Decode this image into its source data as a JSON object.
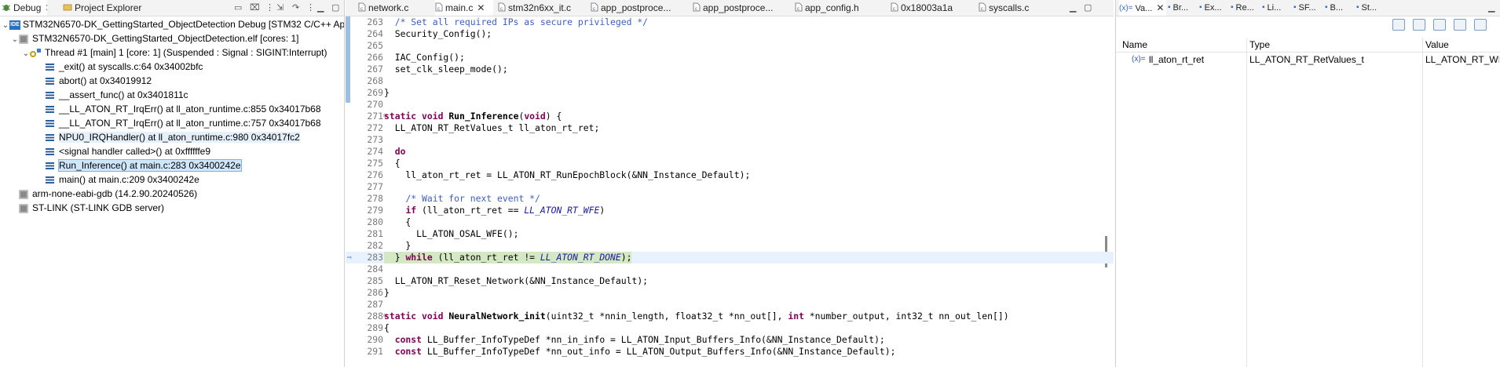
{
  "left_panel": {
    "tabs": [
      {
        "label": "Debug",
        "icon": "debug-bug-icon"
      },
      {
        "label": "Project Explorer",
        "icon": "project-folder-icon"
      }
    ],
    "tree": [
      {
        "level": 0,
        "twist": "open",
        "icon": "ide",
        "text": "STM32N6570-DK_GettingStarted_ObjectDetection Debug [STM32 C/C++ Application]"
      },
      {
        "level": 1,
        "twist": "open",
        "icon": "process",
        "text": "STM32N6570-DK_GettingStarted_ObjectDetection.elf [cores: 1]"
      },
      {
        "level": 2,
        "twist": "open",
        "icon": "thread",
        "text": "Thread #1 [main] 1 [core: 1] (Suspended : Signal : SIGINT:Interrupt)"
      },
      {
        "level": 3,
        "twist": "",
        "icon": "frame",
        "text": "_exit() at syscalls.c:64 0x34002bfc"
      },
      {
        "level": 3,
        "twist": "",
        "icon": "frame",
        "text": "abort() at 0x34019912"
      },
      {
        "level": 3,
        "twist": "",
        "icon": "frame",
        "text": "__assert_func() at 0x3401811c"
      },
      {
        "level": 3,
        "twist": "",
        "icon": "frame",
        "text": "__LL_ATON_RT_IrqErr() at ll_aton_runtime.c:855 0x34017b68"
      },
      {
        "level": 3,
        "twist": "",
        "icon": "frame",
        "text": "__LL_ATON_RT_IrqErr() at ll_aton_runtime.c:757 0x34017b68"
      },
      {
        "level": 3,
        "twist": "",
        "icon": "frame",
        "text": "NPU0_IRQHandler() at ll_aton_runtime.c:980 0x34017fc2",
        "highlight": true
      },
      {
        "level": 3,
        "twist": "",
        "icon": "frame",
        "text": "<signal handler called>() at 0xffffffe9"
      },
      {
        "level": 3,
        "twist": "",
        "icon": "frame",
        "text": "Run_Inference() at main.c:283 0x3400242e",
        "selected": true
      },
      {
        "level": 3,
        "twist": "",
        "icon": "frame",
        "text": "main() at main.c:209 0x3400242e"
      },
      {
        "level": 1,
        "twist": "",
        "icon": "process",
        "text": "arm-none-eabi-gdb (14.2.90.20240526)"
      },
      {
        "level": 1,
        "twist": "",
        "icon": "process",
        "text": "ST-LINK (ST-LINK GDB server)"
      }
    ]
  },
  "editor": {
    "tabs": [
      {
        "label": "network.c",
        "active": false
      },
      {
        "label": "main.c",
        "active": true
      },
      {
        "label": "stm32n6xx_it.c",
        "active": false
      },
      {
        "label": "app_postproce...",
        "active": false
      },
      {
        "label": "app_postproce...",
        "active": false
      },
      {
        "label": "app_config.h",
        "active": false
      },
      {
        "label": "0x18003a1a",
        "active": false
      },
      {
        "label": "syscalls.c",
        "active": false
      }
    ],
    "current_line": "283",
    "lines": [
      {
        "n": "263",
        "fold": "",
        "segs": [
          {
            "t": "  "
          },
          {
            "t": "/* Set all required IPs as secure privileged */",
            "c": "cm"
          }
        ]
      },
      {
        "n": "264",
        "fold": "",
        "segs": [
          {
            "t": "  Security_Config();"
          }
        ]
      },
      {
        "n": "265",
        "fold": "",
        "segs": [
          {
            "t": ""
          }
        ]
      },
      {
        "n": "266",
        "fold": "",
        "segs": [
          {
            "t": "  IAC_Config();"
          }
        ]
      },
      {
        "n": "267",
        "fold": "",
        "segs": [
          {
            "t": "  set_clk_sleep_mode();"
          }
        ]
      },
      {
        "n": "268",
        "fold": "",
        "segs": [
          {
            "t": ""
          }
        ]
      },
      {
        "n": "269",
        "fold": "",
        "segs": [
          {
            "t": "}"
          }
        ]
      },
      {
        "n": "270",
        "fold": "",
        "segs": [
          {
            "t": ""
          }
        ]
      },
      {
        "n": "271",
        "fold": "⊖",
        "segs": [
          {
            "t": "static",
            "c": "kw"
          },
          {
            "t": " "
          },
          {
            "t": "void",
            "c": "kw"
          },
          {
            "t": " "
          },
          {
            "t": "Run_Inference",
            "c": "fn"
          },
          {
            "t": "("
          },
          {
            "t": "void",
            "c": "kw"
          },
          {
            "t": ") {"
          }
        ]
      },
      {
        "n": "272",
        "fold": "",
        "segs": [
          {
            "t": "  LL_ATON_RT_RetValues_t ll_aton_rt_ret;"
          }
        ]
      },
      {
        "n": "273",
        "fold": "",
        "segs": [
          {
            "t": ""
          }
        ]
      },
      {
        "n": "274",
        "fold": "",
        "segs": [
          {
            "t": "  "
          },
          {
            "t": "do",
            "c": "kw"
          }
        ]
      },
      {
        "n": "275",
        "fold": "",
        "segs": [
          {
            "t": "  {"
          }
        ]
      },
      {
        "n": "276",
        "fold": "",
        "segs": [
          {
            "t": "    ll_aton_rt_ret = LL_ATON_RT_RunEpochBlock(&NN_Instance_Default);"
          }
        ]
      },
      {
        "n": "277",
        "fold": "",
        "segs": [
          {
            "t": ""
          }
        ]
      },
      {
        "n": "278",
        "fold": "",
        "segs": [
          {
            "t": "    "
          },
          {
            "t": "/* Wait for next event */",
            "c": "cm"
          }
        ]
      },
      {
        "n": "279",
        "fold": "",
        "segs": [
          {
            "t": "    "
          },
          {
            "t": "if",
            "c": "kw"
          },
          {
            "t": " (ll_aton_rt_ret == "
          },
          {
            "t": "LL_ATON_RT_WFE",
            "c": "mc"
          },
          {
            "t": ")"
          }
        ]
      },
      {
        "n": "280",
        "fold": "",
        "segs": [
          {
            "t": "    {"
          }
        ]
      },
      {
        "n": "281",
        "fold": "",
        "segs": [
          {
            "t": "      LL_ATON_OSAL_WFE();"
          }
        ]
      },
      {
        "n": "282",
        "fold": "",
        "segs": [
          {
            "t": "    }"
          }
        ]
      },
      {
        "n": "283",
        "fold": "",
        "segs": [
          {
            "t": "  } "
          },
          {
            "t": "while",
            "c": "kw"
          },
          {
            "t": " (ll_aton_rt_ret != "
          },
          {
            "t": "LL_ATON_RT_DONE",
            "c": "mc"
          },
          {
            "t": ");"
          }
        ]
      },
      {
        "n": "284",
        "fold": "",
        "segs": [
          {
            "t": ""
          }
        ]
      },
      {
        "n": "285",
        "fold": "",
        "segs": [
          {
            "t": "  LL_ATON_RT_Reset_Network(&NN_Instance_Default);"
          }
        ]
      },
      {
        "n": "286",
        "fold": "",
        "segs": [
          {
            "t": "}"
          }
        ]
      },
      {
        "n": "287",
        "fold": "",
        "segs": [
          {
            "t": ""
          }
        ]
      },
      {
        "n": "288",
        "fold": "⊖",
        "segs": [
          {
            "t": "static",
            "c": "kw"
          },
          {
            "t": " "
          },
          {
            "t": "void",
            "c": "kw"
          },
          {
            "t": " "
          },
          {
            "t": "NeuralNetwork_init",
            "c": "fn"
          },
          {
            "t": "(uint32_t *nnin_length, float32_t *nn_out[], "
          },
          {
            "t": "int",
            "c": "kw"
          },
          {
            "t": " *number_output, int32_t nn_out_len[])"
          }
        ]
      },
      {
        "n": "289",
        "fold": "",
        "segs": [
          {
            "t": "{"
          }
        ]
      },
      {
        "n": "290",
        "fold": "",
        "segs": [
          {
            "t": "  "
          },
          {
            "t": "const",
            "c": "kw"
          },
          {
            "t": " LL_Buffer_InfoTypeDef *nn_in_info = LL_ATON_Input_Buffers_Info(&NN_Instance_Default);"
          }
        ]
      },
      {
        "n": "291",
        "fold": "",
        "segs": [
          {
            "t": "  "
          },
          {
            "t": "const",
            "c": "kw"
          },
          {
            "t": " LL_Buffer_InfoTypeDef *nn_out_info = LL_ATON_Output_Buffers_Info(&NN_Instance_Default);"
          }
        ]
      }
    ]
  },
  "variables": {
    "tabs": [
      {
        "label": "Va...",
        "icon": "variables-icon",
        "active": true
      },
      {
        "label": "Br...",
        "icon": "breakpoints-icon"
      },
      {
        "label": "Ex...",
        "icon": "expressions-icon"
      },
      {
        "label": "Re...",
        "icon": "registers-icon"
      },
      {
        "label": "Li...",
        "icon": "live-expressions-icon"
      },
      {
        "label": "SF...",
        "icon": "sfr-icon"
      },
      {
        "label": "B...",
        "icon": "build-analyzer-icon"
      },
      {
        "label": "St...",
        "icon": "static-stack-icon"
      }
    ],
    "columns": [
      "Name",
      "Type",
      "Value"
    ],
    "rows": [
      {
        "icon": "(x)=",
        "name": "ll_aton_rt_ret",
        "type": "LL_ATON_RT_RetValues_t",
        "value": "LL_ATON_RT_WFE"
      }
    ]
  }
}
